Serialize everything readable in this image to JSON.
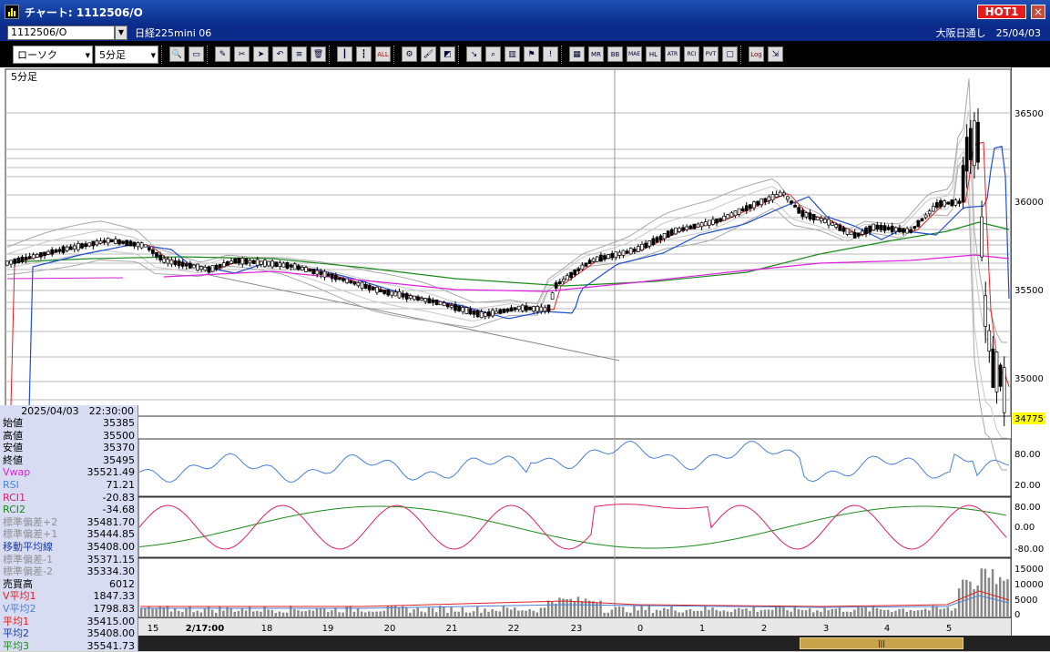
{
  "window": {
    "title": "チャート: 1112506/O",
    "hot_label": "HOT1",
    "close_label": "×"
  },
  "info": {
    "code": "1112506/O",
    "name": "日経225mini 06",
    "right_text": "大阪日通し　25/04/03"
  },
  "toolbar": {
    "chart_type": "ローソク",
    "interval": "5分足",
    "buttons": [
      "zoom",
      "frame",
      "pen",
      "cut",
      "pointer",
      "undo",
      "list",
      "trash",
      "candle",
      "candle2",
      "all",
      "gear",
      "brush",
      "palette",
      "cursor",
      "search",
      "bar",
      "flag",
      "info",
      "mfg",
      "mr",
      "bb",
      "mae",
      "hl",
      "atr",
      "rsi",
      "pvt",
      "box",
      "log",
      "export"
    ],
    "labels": {
      "all": "ALL",
      "mr": "MR",
      "bb": "BB",
      "mae": "MAE",
      "hl": "HL",
      "atr": "ATR",
      "rsi": "RCI",
      "pvt": "PVT",
      "log": "Log"
    }
  },
  "chart": {
    "period_label": "5分足",
    "last_price": "34775",
    "price_ticks": [
      "36500",
      "36000",
      "35500",
      "35000"
    ],
    "rsi_ticks": [
      "80.00",
      "20.00"
    ],
    "rci_ticks": [
      "80.00",
      "0.00",
      "-80.00"
    ],
    "volume_ticks": [
      "15000",
      "10000",
      "5000",
      "0"
    ],
    "x_labels": [
      "15",
      "2/17:00",
      "18",
      "19",
      "20",
      "21",
      "22",
      "23",
      "0",
      "1",
      "2",
      "3",
      "4",
      "5"
    ]
  },
  "panel": {
    "datetime": "2025/04/03　22:30:00",
    "rows": [
      {
        "label": "始値",
        "value": "35385",
        "color": "#000000"
      },
      {
        "label": "高値",
        "value": "35500",
        "color": "#000000"
      },
      {
        "label": "安値",
        "value": "35370",
        "color": "#000000"
      },
      {
        "label": "終値",
        "value": "35495",
        "color": "#000000"
      },
      {
        "label": "Vwap",
        "value": "35521.49",
        "color": "#e020e0"
      },
      {
        "label": "RSI",
        "value": "71.21",
        "color": "#4a7fd8"
      },
      {
        "label": "RCI1",
        "value": "-20.83",
        "color": "#e0206a"
      },
      {
        "label": "RCI2",
        "value": "-34.68",
        "color": "#1a8a1a"
      },
      {
        "label": "標準偏差+2",
        "value": "35481.70",
        "color": "#909090"
      },
      {
        "label": "標準偏差+1",
        "value": "35444.85",
        "color": "#909090"
      },
      {
        "label": "移動平均線",
        "value": "35408.00",
        "color": "#1a3aa8"
      },
      {
        "label": "標準偏差-1",
        "value": "35371.15",
        "color": "#909090"
      },
      {
        "label": "標準偏差-2",
        "value": "35334.30",
        "color": "#909090"
      },
      {
        "label": "売買高",
        "value": "6012",
        "color": "#000000"
      },
      {
        "label": "V平均1",
        "value": "1847.33",
        "color": "#e02020"
      },
      {
        "label": "V平均2",
        "value": "1798.83",
        "color": "#4a7fd8"
      },
      {
        "label": "平均1",
        "value": "35415.00",
        "color": "#e02020"
      },
      {
        "label": "平均2",
        "value": "35408.00",
        "color": "#1a3aa8"
      },
      {
        "label": "平均3",
        "value": "35541.73",
        "color": "#1a8a1a"
      }
    ]
  },
  "colors": {
    "ma1": "#e02020",
    "ma2": "#2050d0",
    "ma3": "#1a8a1a",
    "vwap": "#e020e0",
    "bb": "#a8a8a8",
    "rsi": "#4a7fd8"
  }
}
